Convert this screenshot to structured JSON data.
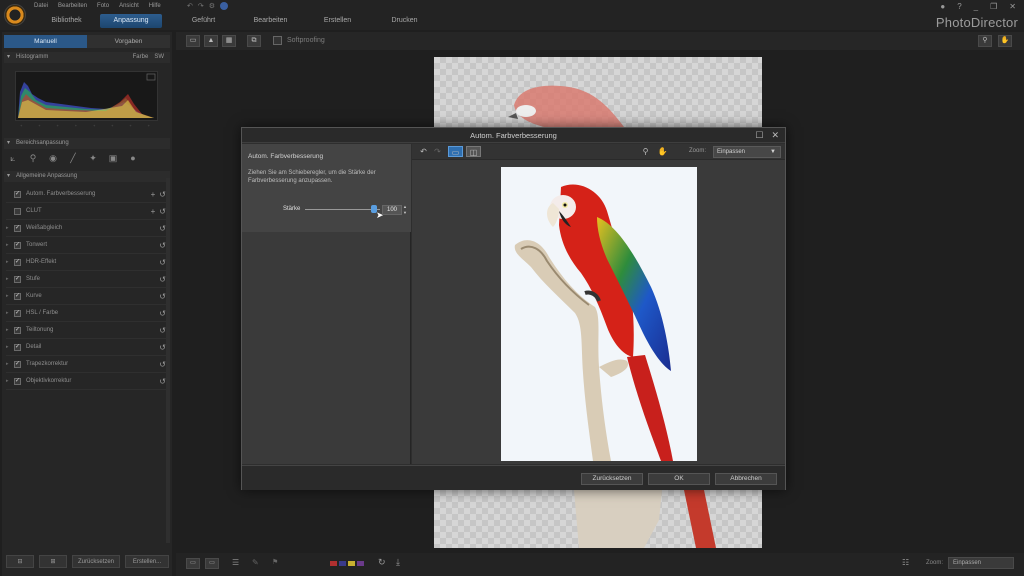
{
  "app": {
    "brand": "PhotoDirector",
    "menu": [
      "Datei",
      "Bearbeiten",
      "Foto",
      "Ansicht",
      "Hilfe"
    ],
    "nav_tabs": [
      "Bibliothek",
      "Anpassung",
      "Geführt",
      "Bearbeiten",
      "Erstellen",
      "Drucken"
    ],
    "active_tab": "Anpassung",
    "window_controls": [
      "?",
      "_",
      "❐",
      "✕"
    ]
  },
  "left_panel": {
    "mode_tabs": [
      "Manuell",
      "Vorgaben"
    ],
    "histogram_title": "Histogramm",
    "histogram_modes": [
      "Farbe",
      "SW"
    ],
    "region_title": "Bereichsanpassung",
    "general_title": "Allgemeine Anpassung",
    "adjustments": [
      {
        "label": "Autom. Farbverbesserung",
        "checked": true,
        "expand": false,
        "add": true
      },
      {
        "label": "CLUT",
        "checked": false,
        "expand": false,
        "add": true
      },
      {
        "label": "Weißabgleich",
        "checked": true,
        "expand": true,
        "add": false
      },
      {
        "label": "Tonwert",
        "checked": true,
        "expand": true,
        "add": false
      },
      {
        "label": "HDR-Effekt",
        "checked": true,
        "expand": true,
        "add": false
      },
      {
        "label": "Stufe",
        "checked": true,
        "expand": true,
        "add": false
      },
      {
        "label": "Kurve",
        "checked": true,
        "expand": true,
        "add": false
      },
      {
        "label": "HSL / Farbe",
        "checked": true,
        "expand": true,
        "add": false
      },
      {
        "label": "Teiltonung",
        "checked": true,
        "expand": true,
        "add": false
      },
      {
        "label": "Detail",
        "checked": true,
        "expand": true,
        "add": false
      },
      {
        "label": "Trapezkorrektur",
        "checked": true,
        "expand": true,
        "add": false
      },
      {
        "label": "Objektivkorrektur",
        "checked": true,
        "expand": true,
        "add": false
      }
    ],
    "bottom_buttons": [
      "Zurücksetzen",
      "Erstellen..."
    ]
  },
  "workspace": {
    "softproofing": "Softproofing",
    "zoom_label": "Zoom:",
    "zoom_value": "Einpassen"
  },
  "dialog": {
    "title": "Autom. Farbverbesserung",
    "heading": "Autom. Farbverbesserung",
    "description": "Ziehen Sie am Schieberegler, um die Stärke der Farbverbesserung anzupassen.",
    "slider_label": "Stärke",
    "slider_value": "100",
    "slider_fraction": 0.92,
    "zoom_label": "Zoom:",
    "zoom_value": "Einpassen",
    "buttons": {
      "reset": "Zurücksetzen",
      "ok": "OK",
      "cancel": "Abbrechen"
    }
  }
}
